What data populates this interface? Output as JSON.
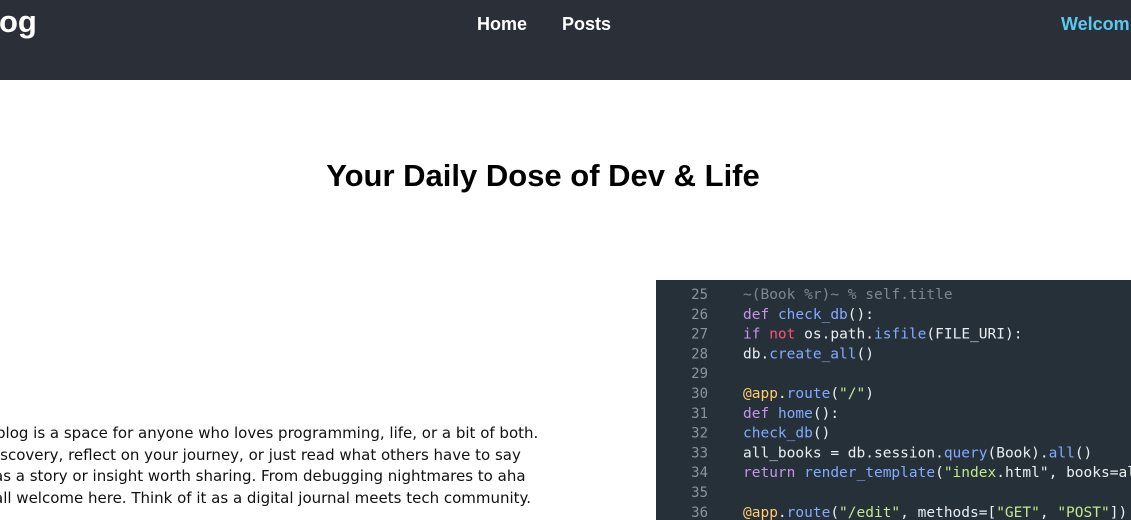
{
  "navbar": {
    "brand": "og",
    "links": [
      {
        "label": "Home"
      },
      {
        "label": "Posts"
      }
    ],
    "welcome": "Welcom"
  },
  "hero": {
    "title": "Your Daily Dose of Dev & Life"
  },
  "intro": {
    "lines": [
      "blog is a space for anyone who loves programming, life, or a bit of both.",
      "iscovery, reflect on your journey, or just read what others have to say",
      "as a story or insight worth sharing. From debugging nightmares to aha",
      "all welcome here. Think of it as a digital journal meets tech community."
    ]
  },
  "code_image": {
    "lines": [
      {
        "num": "25",
        "text": "~(Book %r)~ % self.title"
      },
      {
        "num": "26",
        "text": "def check_db():"
      },
      {
        "num": "27",
        "text": "    if not os.path.isfile(FILE_URI):"
      },
      {
        "num": "28",
        "text": "        db.create_all()"
      },
      {
        "num": "29",
        "text": ""
      },
      {
        "num": "30",
        "text": "@app.route(\"/\")"
      },
      {
        "num": "31",
        "text": "def home():"
      },
      {
        "num": "32",
        "text": "    check_db()"
      },
      {
        "num": "33",
        "text": "    all_books = db.session.query(Book).all()"
      },
      {
        "num": "34",
        "text": "    return render_template(\"index.html\", books=all_books)"
      },
      {
        "num": "35",
        "text": ""
      },
      {
        "num": "36",
        "text": "@app.route(\"/edit\", methods=[\"GET\", \"POST\"])"
      }
    ]
  },
  "colors": {
    "navbar_bg": "#2b3038",
    "welcome": "#5bc8f0",
    "code_bg": "#263038"
  }
}
